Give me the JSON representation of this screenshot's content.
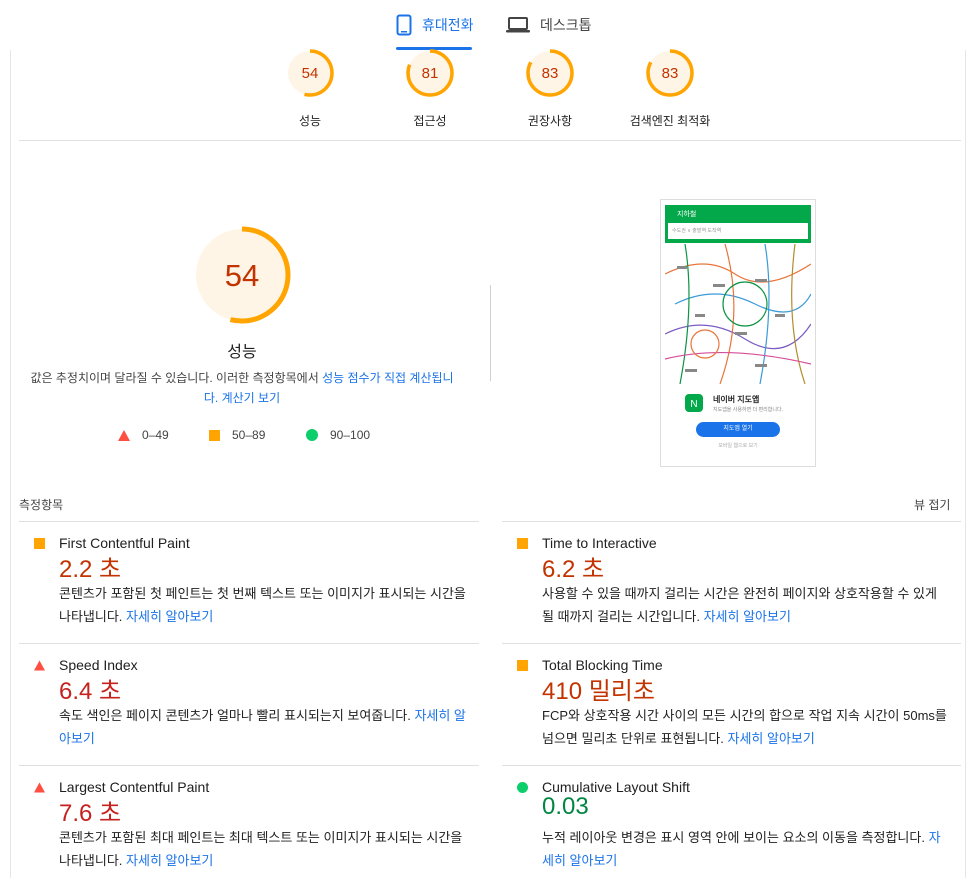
{
  "tabs": {
    "mobile_label": "휴대전화",
    "desktop_label": "데스크톱"
  },
  "summary_scores": [
    {
      "score": "54",
      "label": "성능"
    },
    {
      "score": "81",
      "label": "접근성"
    },
    {
      "score": "83",
      "label": "권장사항"
    },
    {
      "score": "83",
      "label": "검색엔진 최적화"
    }
  ],
  "performance": {
    "score": "54",
    "title": "성능",
    "desc_prefix": "값은 추정치이며 달라질 수 있습니다. 이러한 측정항목에서 ",
    "desc_link1": "성능 점수가 직접 계산됩니",
    "desc_link2": "다. 계산기 보기",
    "legend": {
      "fail": "0–49",
      "average": "50–89",
      "pass": "90–100"
    }
  },
  "thumbnail": {
    "app_title": "지하철",
    "search_text": "수도권 ∨  출발역           도착역",
    "card_title": "네이버 지도앱",
    "card_sub": "지도앱을 사용하면 더 편리합니다.",
    "card_button": "지도앱 열기",
    "card_footer": "모바일 웹으로 보기"
  },
  "metrics": {
    "header": "측정항목",
    "collapse_label": "뷰 접기",
    "more": "자세히 알아보기",
    "items": [
      {
        "title": "First Contentful Paint",
        "value": "2.2 초",
        "status": "average",
        "desc": "콘텐츠가 포함된 첫 페인트는 첫 번째 텍스트 또는 이미지가 표시되는 시간을 나타냅니다. ",
        "link": "자세히 알아보기"
      },
      {
        "title": "Time to Interactive",
        "value": "6.2 초",
        "status": "average",
        "desc": "사용할 수 있을 때까지 걸리는 시간은 완전히 페이지와 상호작용할 수 있게 될 때까지 걸리는 시간입니다. ",
        "link": "자세히 알아보기"
      },
      {
        "title": "Speed Index",
        "value": "6.4 초",
        "status": "fail",
        "desc": "속도 색인은 페이지 콘텐츠가 얼마나 빨리 표시되는지 보여줍니다. ",
        "link": "자세히 알아보기"
      },
      {
        "title": "Total Blocking Time",
        "value": "410 밀리초",
        "status": "average",
        "desc": "FCP와 상호작용 시간 사이의 모든 시간의 합으로 작업 지속 시간이 50ms를 넘으면 밀리초 단위로 표현됩니다. ",
        "link": "자세히 알아보기"
      },
      {
        "title": "Largest Contentful Paint",
        "value": "7.6 초",
        "status": "fail",
        "desc": "콘텐츠가 포함된 최대 페인트는 최대 텍스트 또는 이미지가 표시되는 시간을 나타냅니다. ",
        "link": "자세히 알아보기"
      },
      {
        "title": "Cumulative Layout Shift",
        "value": "0.03",
        "status": "pass",
        "desc": "누적 레이아웃 변경은 표시 영역 안에 보이는 요소의 이동을 측정합니다. ",
        "link": "자세히 알아보기"
      }
    ]
  },
  "colors": {
    "accent": "#1a73e8",
    "average": "#ffa400",
    "fail": "#ff4e42",
    "pass": "#0cce6b"
  }
}
